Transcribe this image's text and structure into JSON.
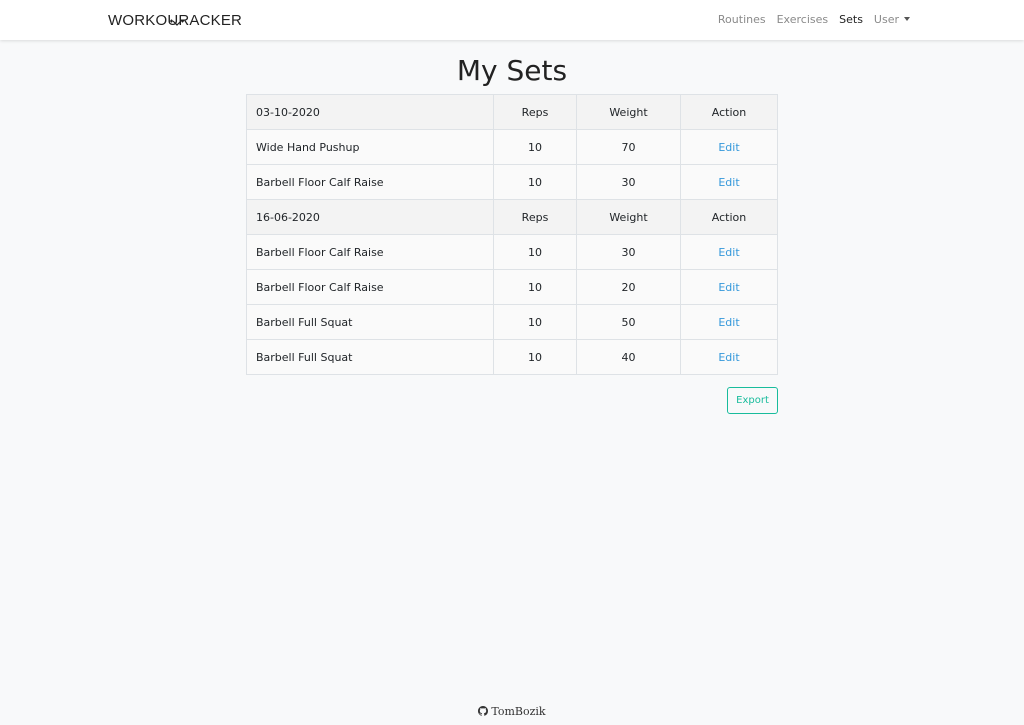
{
  "navbar": {
    "brand_pre": "WORKOU",
    "brand_post": "RACKER",
    "links": [
      "Routines",
      "Exercises",
      "Sets",
      "User"
    ],
    "active": "Sets"
  },
  "page": {
    "title": "My Sets"
  },
  "groups": [
    {
      "date": "03-10-2020",
      "headers": {
        "reps": "Reps",
        "weight": "Weight",
        "action": "Action"
      },
      "rows": [
        {
          "exercise": "Wide Hand Pushup",
          "reps": "10",
          "weight": "70",
          "action": "Edit"
        },
        {
          "exercise": "Barbell Floor Calf Raise",
          "reps": "10",
          "weight": "30",
          "action": "Edit"
        }
      ]
    },
    {
      "date": "16-06-2020",
      "headers": {
        "reps": "Reps",
        "weight": "Weight",
        "action": "Action"
      },
      "rows": [
        {
          "exercise": "Barbell Floor Calf Raise",
          "reps": "10",
          "weight": "30",
          "action": "Edit"
        },
        {
          "exercise": "Barbell Floor Calf Raise",
          "reps": "10",
          "weight": "20",
          "action": "Edit"
        },
        {
          "exercise": "Barbell Full Squat",
          "reps": "10",
          "weight": "50",
          "action": "Edit"
        },
        {
          "exercise": "Barbell Full Squat",
          "reps": "10",
          "weight": "40",
          "action": "Edit"
        }
      ]
    }
  ],
  "export_label": "Export",
  "footer": {
    "text": "TomBozik",
    "icon": "github-icon"
  },
  "colors": {
    "accent": "#18bc9c",
    "link": "#3498db",
    "background": "#f8f9fa"
  }
}
